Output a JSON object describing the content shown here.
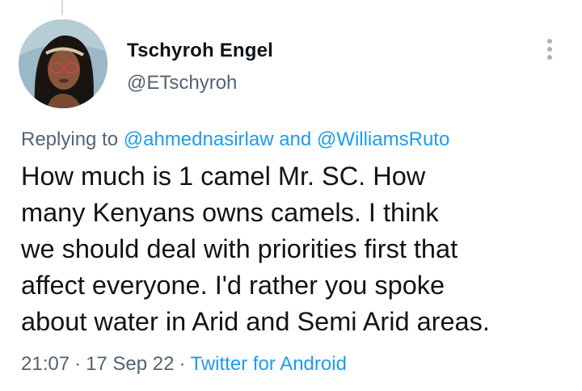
{
  "tweet": {
    "author": {
      "display_name": "Tschyroh Engel",
      "handle": "@ETschyroh",
      "avatar_icon": "profile-photo"
    },
    "more_icon": "vertical-dots-icon",
    "replying_to": {
      "prefix": "Replying to",
      "mentions": [
        "@ahmednasirlaw",
        "@WilliamsRuto"
      ],
      "joiner": "and"
    },
    "body_lines": [
      "How much is 1 camel Mr. SC. How",
      "many Kenyans owns camels. I  think",
      "we should deal with priorities first that",
      "affect everyone. I'd rather you spoke",
      "about water in Arid and Semi Arid areas."
    ],
    "time": "21:07",
    "date": "17 Sep 22",
    "separator": "·",
    "source": "Twitter for Android"
  },
  "colors": {
    "text": "#0f1419",
    "secondary": "#536471",
    "link": "#1d9bf0",
    "thread_line": "#cfd9de"
  }
}
